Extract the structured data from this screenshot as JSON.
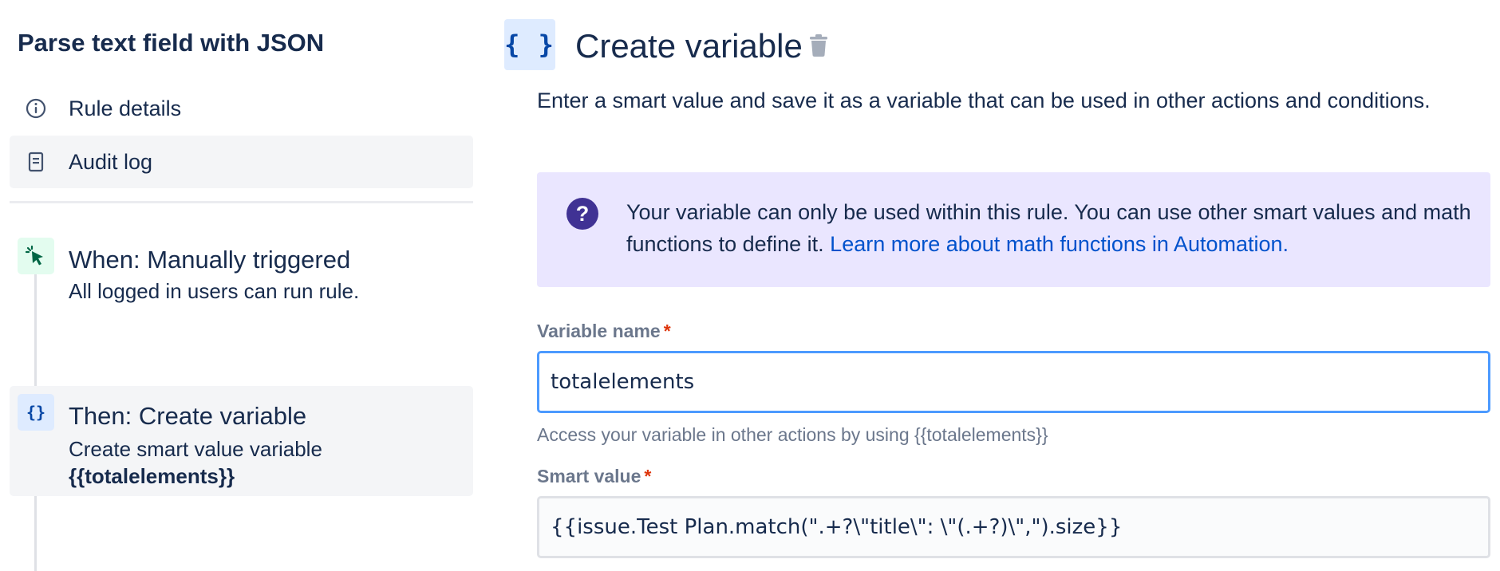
{
  "sidebar": {
    "rule_title": "Parse text field with JSON",
    "nav": [
      {
        "label": "Rule details",
        "icon": "info-icon"
      },
      {
        "label": "Audit log",
        "icon": "document-icon"
      }
    ],
    "steps": [
      {
        "title": "When: Manually triggered",
        "description": "All logged in users can run rule.",
        "icon": "cursor-click-icon"
      },
      {
        "title": "Then: Create variable",
        "description": "Create smart value variable",
        "description_bold": "{{totalelements}}",
        "icon": "curly-braces-icon"
      }
    ]
  },
  "main": {
    "header_icon_text": "{ }",
    "title": "Create variable",
    "description": "Enter a smart value and save it as a variable that can be used in other actions and conditions.",
    "info": {
      "text": "Your variable can only be used within this rule. You can use other smart values and math functions to define it.",
      "link": "Learn more about math functions in Automation.",
      "icon_glyph": "?"
    },
    "variable_name": {
      "label": "Variable name",
      "required_mark": "*",
      "value": "totalelements",
      "helper": "Access your variable in other actions by using {{totalelements}}"
    },
    "smart_value": {
      "label": "Smart value",
      "required_mark": "*",
      "value": "{{issue.Test Plan.match(\".+?\\\"title\\\": \\\"(.+?)\\\",\").size}}"
    }
  },
  "colors": {
    "text": "#172b4d",
    "muted": "#6b778c",
    "link": "#0052cc",
    "info_bg": "#eae6ff",
    "info_icon": "#403294",
    "focus_border": "#4c9aff",
    "required": "#de350b",
    "trigger_icon_bg": "#e3fcef",
    "action_icon_bg": "#deebff"
  }
}
